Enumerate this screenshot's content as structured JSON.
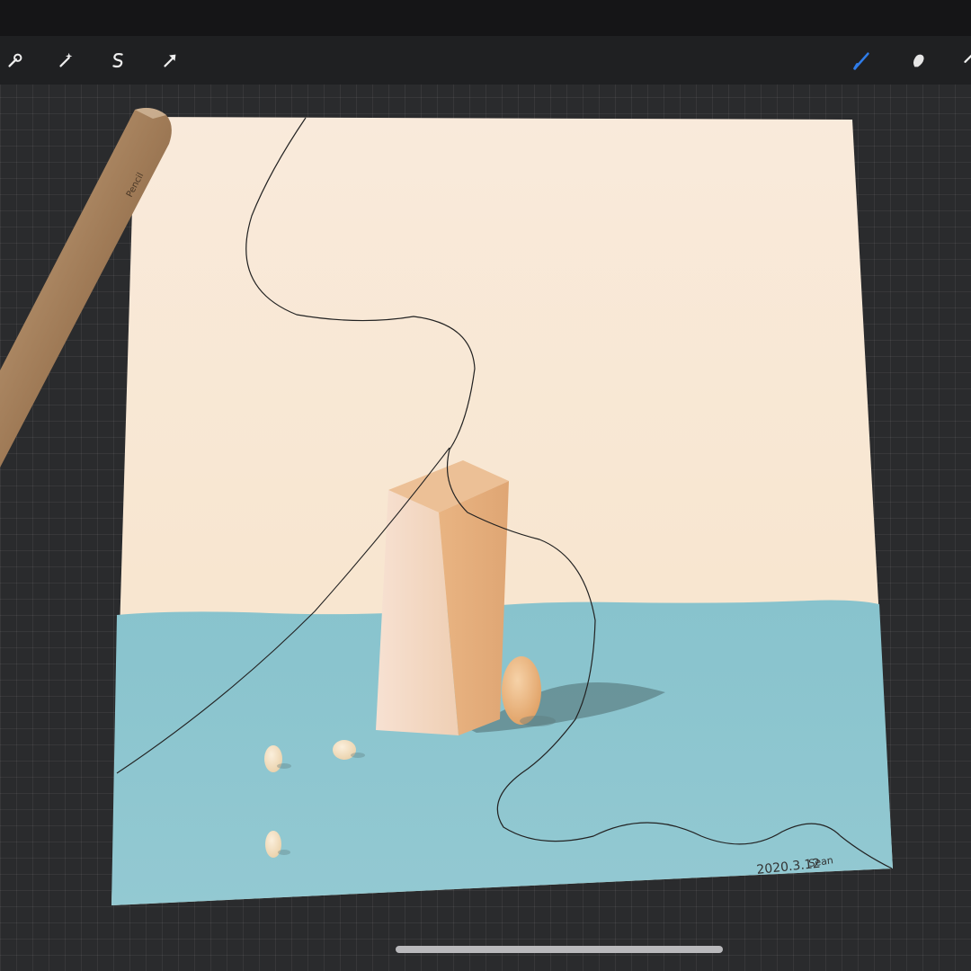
{
  "toolbar": {
    "left_tools": [
      {
        "name": "actions",
        "icon": "wrench-icon"
      },
      {
        "name": "adjustments",
        "icon": "magic-wand-icon"
      },
      {
        "name": "selection",
        "icon": "selection-s-icon"
      },
      {
        "name": "transform",
        "icon": "arrow-cursor-icon"
      }
    ],
    "right_tools": [
      {
        "name": "brush",
        "icon": "brush-icon",
        "active": true,
        "color": "#2f7ce8"
      },
      {
        "name": "smudge",
        "icon": "smudge-icon"
      }
    ]
  },
  "canvas": {
    "signature": "2020.3.12",
    "signature_name": "Sean"
  },
  "colors": {
    "sky": "#f7e6d2",
    "table": "#8fc6d0",
    "block": "#f0cfa6",
    "egg": "#e9b27a",
    "accent": "#2f7ce8"
  },
  "stylus_label": "Pencil"
}
